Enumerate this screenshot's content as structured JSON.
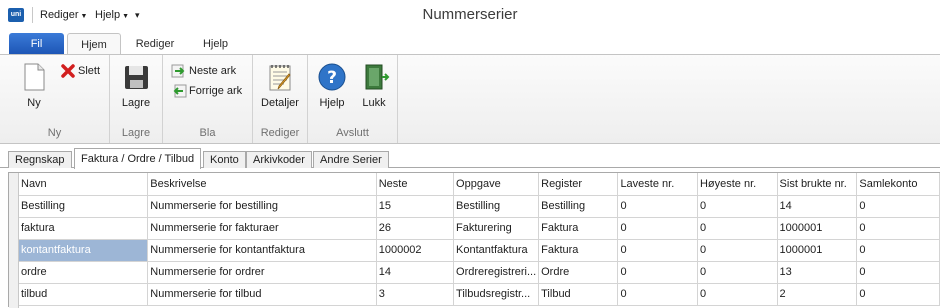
{
  "titlebar": {
    "app_icon_text": "uni",
    "menus": [
      "Rediger",
      "Hjelp"
    ],
    "title": "Nummerserier"
  },
  "ribbon": {
    "file_tab": "Fil",
    "tabs": [
      "Hjem",
      "Rediger",
      "Hjelp"
    ],
    "groups": {
      "ny": {
        "label": "Ny",
        "new_button": "Ny",
        "delete_button": "Slett"
      },
      "lagre": {
        "label": "Lagre",
        "save_button": "Lagre"
      },
      "bla": {
        "label": "Bla",
        "next_button": "Neste ark",
        "prev_button": "Forrige ark"
      },
      "rediger": {
        "label": "Rediger",
        "details_button": "Detaljer"
      },
      "avslutt": {
        "label": "Avslutt",
        "help_button": "Hjelp",
        "close_button": "Lukk"
      }
    }
  },
  "doc_tabs": [
    "Regnskap",
    "Faktura / Ordre / Tilbud",
    "Konto",
    "Arkivkoder",
    "Andre Serier"
  ],
  "grid": {
    "columns": [
      "Navn",
      "Beskrivelse",
      "Neste",
      "Oppgave",
      "Register",
      "Laveste nr.",
      "Høyeste nr.",
      "Sist brukte nr.",
      "Samlekonto"
    ],
    "rows": [
      [
        "Bestilling",
        "Nummerserie for bestilling",
        "15",
        "Bestilling",
        "Bestilling",
        "0",
        "0",
        "14",
        "0"
      ],
      [
        "faktura",
        "Nummerserie for fakturaer",
        "26",
        "Fakturering",
        "Faktura",
        "0",
        "0",
        "1000001",
        "0"
      ],
      [
        "kontantfaktura",
        "Nummerserie for kontantfaktura",
        "1000002",
        "Kontantfaktura",
        "Faktura",
        "0",
        "0",
        "1000001",
        "0"
      ],
      [
        "ordre",
        "Nummerserie for ordrer",
        "14",
        "Ordreregistreri...",
        "Ordre",
        "0",
        "0",
        "13",
        "0"
      ],
      [
        "tilbud",
        "Nummerserie for tilbud",
        "3",
        "Tilbudsregistr...",
        "Tilbud",
        "0",
        "0",
        "2",
        "0"
      ]
    ]
  },
  "colors": {
    "file_tab": "#1c54b4",
    "selected_cell": "#9db6d6"
  }
}
